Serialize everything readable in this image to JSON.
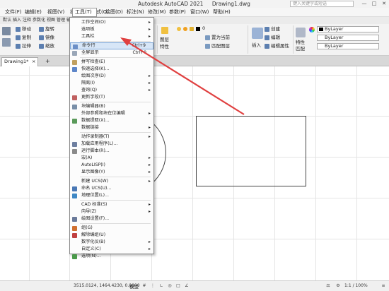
{
  "window": {
    "app_title": "Autodesk AutoCAD 2021",
    "file_title": "Drawing1.dwg",
    "search_placeholder": "键入关键字或短语",
    "btn_min": "—",
    "btn_max": "□",
    "btn_close": "✕"
  },
  "menubar": {
    "items": [
      "文件(F)",
      "编辑(E)",
      "视图(V)",
      "插入(I)",
      "格式(O)",
      "工具(T)",
      "绘图(D)",
      "标注(N)",
      "修改(M)",
      "参数(P)",
      "窗口(W)",
      "帮助(H)"
    ]
  },
  "ribbon_tabs": [
    "默认",
    "插入",
    "注释",
    "参数化",
    "视图",
    "管理",
    "输出",
    "附加"
  ],
  "ribbon": {
    "modify": [
      "移动",
      "旋转",
      "复制",
      "镜像",
      "拉伸",
      "缩放"
    ],
    "layer_value": "0",
    "layer_btns": [
      "置为当前",
      "匹配图层"
    ],
    "layer_label": "图层",
    "layer_label2": "特性",
    "insert_label": "插入",
    "block_btns": [
      "创建",
      "编辑",
      "编辑属性"
    ],
    "props_label": "特性",
    "match_label": "匹配",
    "bylayer": [
      "ByLayer",
      "ByLayer",
      "ByLayer"
    ]
  },
  "file_tab": {
    "name": "Drawing1*",
    "close": "×",
    "add": "+"
  },
  "tools_menu": {
    "items": [
      {
        "label": "工作空间(O)",
        "sub": true
      },
      {
        "label": "选项板",
        "sub": true
      },
      {
        "label": "工具栏",
        "sub": true
      },
      {
        "label": "命令行",
        "shortcut": "Ctrl+9",
        "highlight": true,
        "icon": "#6b8fc7"
      },
      {
        "label": "全屏显示",
        "shortcut": "Ctrl+0",
        "icon": "#9aa7b8"
      },
      {
        "label": "拼写检查(E)",
        "icon": "#c0a060"
      },
      {
        "label": "快速选择(K)...",
        "icon": "#5d86c9"
      },
      {
        "label": "绘图次序(D)",
        "sub": true
      },
      {
        "label": "隔离(I)",
        "sub": true
      },
      {
        "label": "查询(Q)",
        "sub": true
      },
      {
        "label": "更新字段(T)",
        "icon": "#c06060"
      },
      {
        "label": "块编辑器(B)",
        "icon": "#7a8fa8"
      },
      {
        "label": "外部参照和块在位编辑",
        "sub": true
      },
      {
        "label": "数据提取(X)...",
        "icon": "#5a9a5a"
      },
      {
        "label": "数据链接",
        "sub": true
      },
      {
        "label": "动作录制器(T)",
        "sub": true
      },
      {
        "label": "加载应用程序(L)...",
        "icon": "#6e7fa0"
      },
      {
        "label": "运行脚本(R)...",
        "icon": "#8a8a8a"
      },
      {
        "label": "宏(A)",
        "sub": true
      },
      {
        "label": "AutoLISP(I)",
        "sub": true
      },
      {
        "label": "显示图像(Y)",
        "sub": true
      },
      {
        "label": "新建 UCS(W)",
        "sub": true
      },
      {
        "label": "命名 UCS(U)...",
        "icon": "#4a78b5"
      },
      {
        "label": "地理位置(L)...",
        "icon": "#3f88c5"
      },
      {
        "label": "CAD 标准(S)",
        "sub": true
      },
      {
        "label": "向导(Z)",
        "sub": true
      },
      {
        "label": "绘图设置(F)...",
        "icon": "#6a7a9a"
      },
      {
        "label": "组(G)",
        "icon": "#d07030"
      },
      {
        "label": "解除编组(U)",
        "icon": "#c04040"
      },
      {
        "label": "数字化仪(B)",
        "sub": true
      },
      {
        "label": "自定义(C)",
        "sub": true
      },
      {
        "label": "选项(N)...",
        "icon": "#4a9a4a"
      }
    ]
  },
  "status": {
    "coords": "3515.0124, 1464.4230, 0.0000",
    "model": "模型",
    "scale": "1:1 / 100%"
  },
  "colors": {
    "annotation_arrow": "#e04040",
    "menu_highlight": "#d7e6f7"
  }
}
